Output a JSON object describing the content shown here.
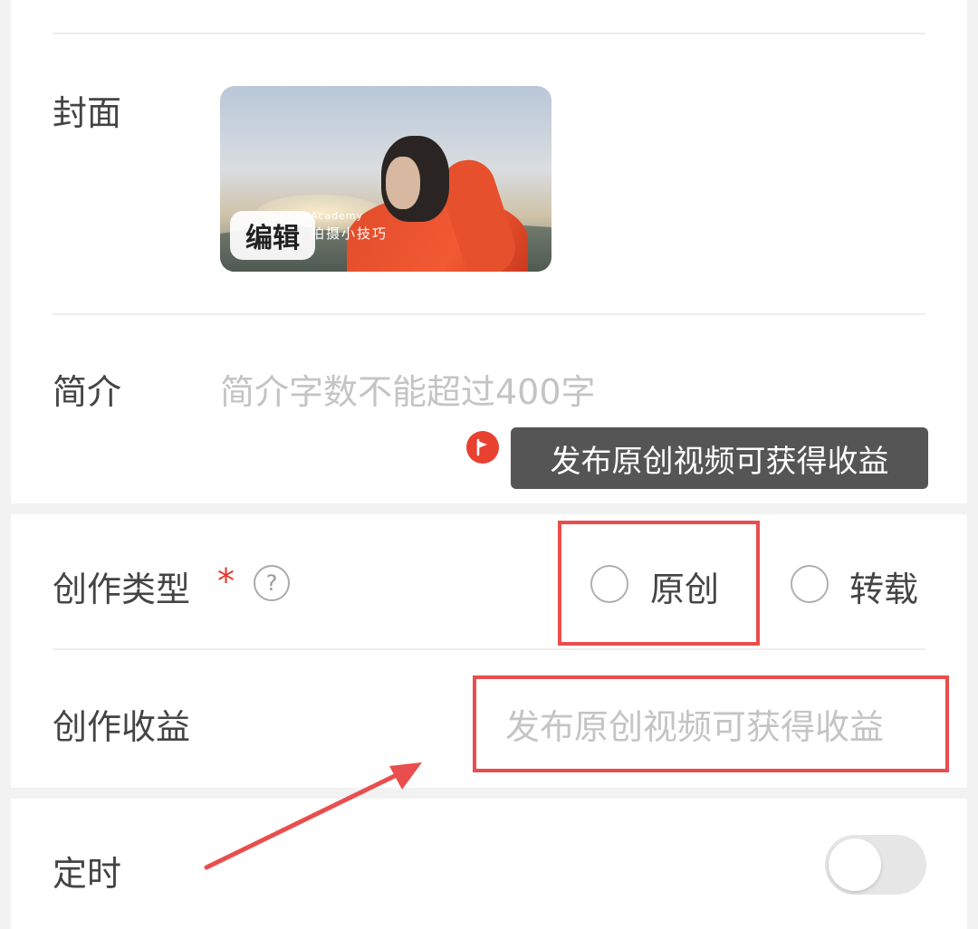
{
  "cover": {
    "label": "封面",
    "edit_label": "编辑",
    "overlay_line1": "Academy",
    "overlay_line2": "拍摄小技巧"
  },
  "intro": {
    "label": "简介",
    "placeholder": "简介字数不能超过400字"
  },
  "tooltip": {
    "icon": "flag-badge-icon",
    "text": "发布原创视频可获得收益"
  },
  "creation_type": {
    "label": "创作类型",
    "required_mark": "*",
    "help_glyph": "?",
    "options": [
      {
        "label": "原创",
        "selected": false
      },
      {
        "label": "转载",
        "selected": false
      }
    ]
  },
  "revenue": {
    "label": "创作收益",
    "value_placeholder": "发布原创视频可获得收益"
  },
  "schedule": {
    "label": "定时",
    "enabled": false
  },
  "colors": {
    "accent_red": "#e8412f",
    "annotation_red": "#ea4d4d",
    "placeholder_gray": "#c4c4c4",
    "tooltip_bg": "#555555"
  }
}
